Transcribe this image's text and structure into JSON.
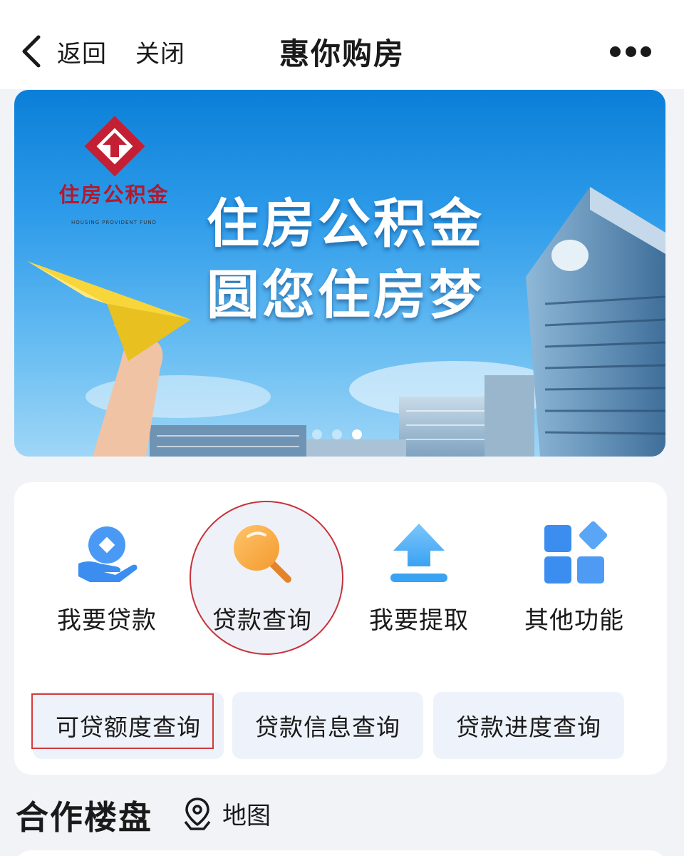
{
  "nav": {
    "back_label": "返回",
    "close_label": "关闭",
    "title": "惠你购房",
    "more_icon": "more-dots-icon"
  },
  "banner": {
    "logo_text_cn": "住房公积金",
    "logo_text_en": "HOUSING PROVIDENT FUND",
    "headline_line1": "住房公积金",
    "headline_line2": "圆您住房梦",
    "slide_count": 3,
    "active_slide": 3
  },
  "services": {
    "items": [
      {
        "label": "我要贷款",
        "icon": "loan-hand-icon"
      },
      {
        "label": "贷款查询",
        "icon": "search-magnifier-icon"
      },
      {
        "label": "我要提取",
        "icon": "withdraw-upload-icon"
      },
      {
        "label": "其他功能",
        "icon": "grid-apps-icon"
      }
    ],
    "quick_buttons": [
      {
        "label": "可贷额度查询"
      },
      {
        "label": "贷款信息查询"
      },
      {
        "label": "贷款进度查询"
      }
    ]
  },
  "cooperation": {
    "title": "合作楼盘",
    "map_label": "地图",
    "map_icon": "map-pin-icon"
  },
  "colors": {
    "accent_blue": "#3b8ef0",
    "highlight_red": "#c8323a",
    "logo_red": "#b3192d"
  }
}
